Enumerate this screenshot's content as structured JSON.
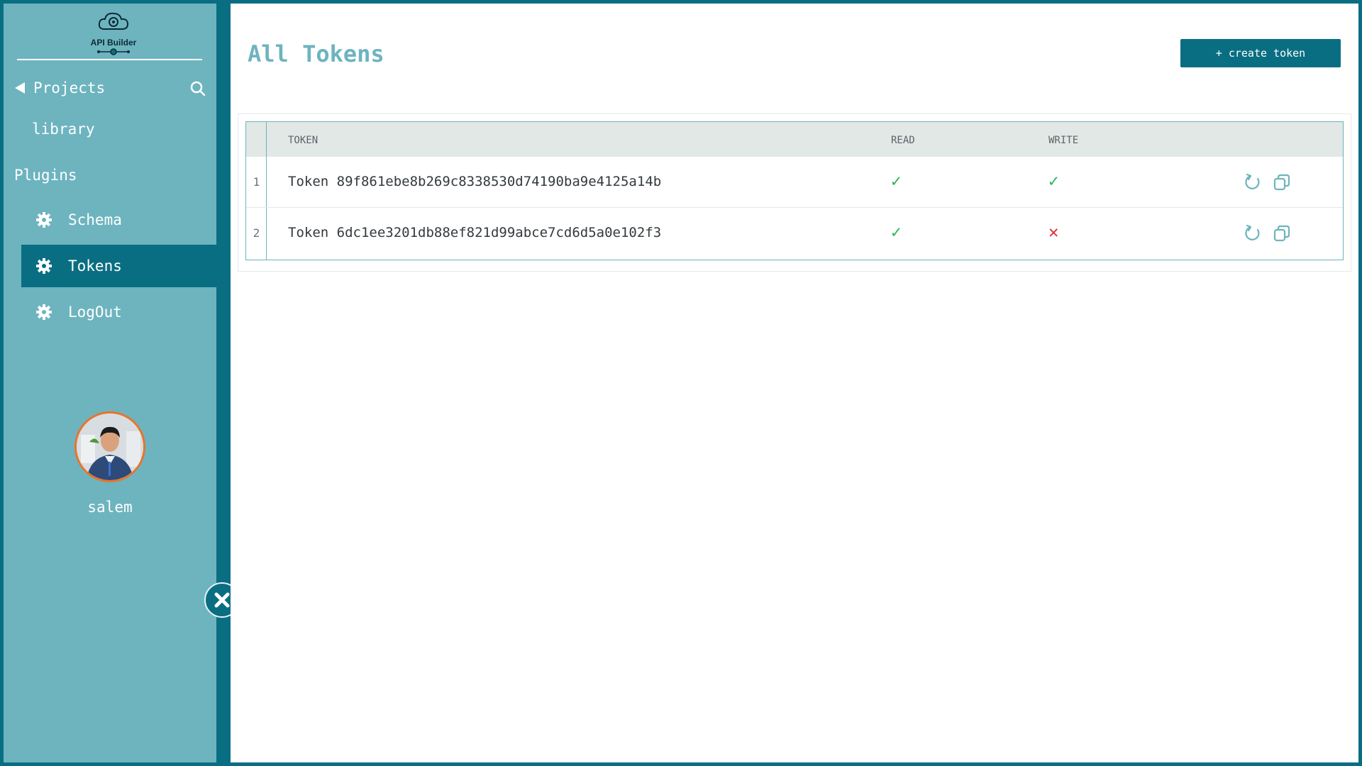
{
  "sidebar": {
    "logo_text": "API Builder",
    "projects_label": "Projects",
    "project_item": "library",
    "plugins_label": "Plugins",
    "nav": [
      {
        "label": "Schema",
        "icon": "gear-icon"
      },
      {
        "label": "Tokens",
        "icon": "gear-icon",
        "active": true
      },
      {
        "label": "LogOut",
        "icon": "gear-icon"
      }
    ],
    "username": "salem"
  },
  "main": {
    "title": "All Tokens",
    "create_button": "+ create token",
    "table": {
      "headers": [
        "TOKEN",
        "READ",
        "WRITE"
      ],
      "rows": [
        {
          "index": "1",
          "token": "Token 89f861ebe8b269c8338530d74190ba9e4125a14b",
          "read": "✓",
          "write": "✓"
        },
        {
          "index": "2",
          "token": "Token 6dc1ee3201db88ef821d99abce7cd6d5a0e102f3",
          "read": "✓",
          "write": "✕"
        }
      ]
    }
  },
  "colors": {
    "primary": "#0a6e82",
    "sidebar": "#6db4bf",
    "check": "#2fb45a",
    "cross": "#e0303a",
    "avatar_ring": "#e8742a"
  }
}
